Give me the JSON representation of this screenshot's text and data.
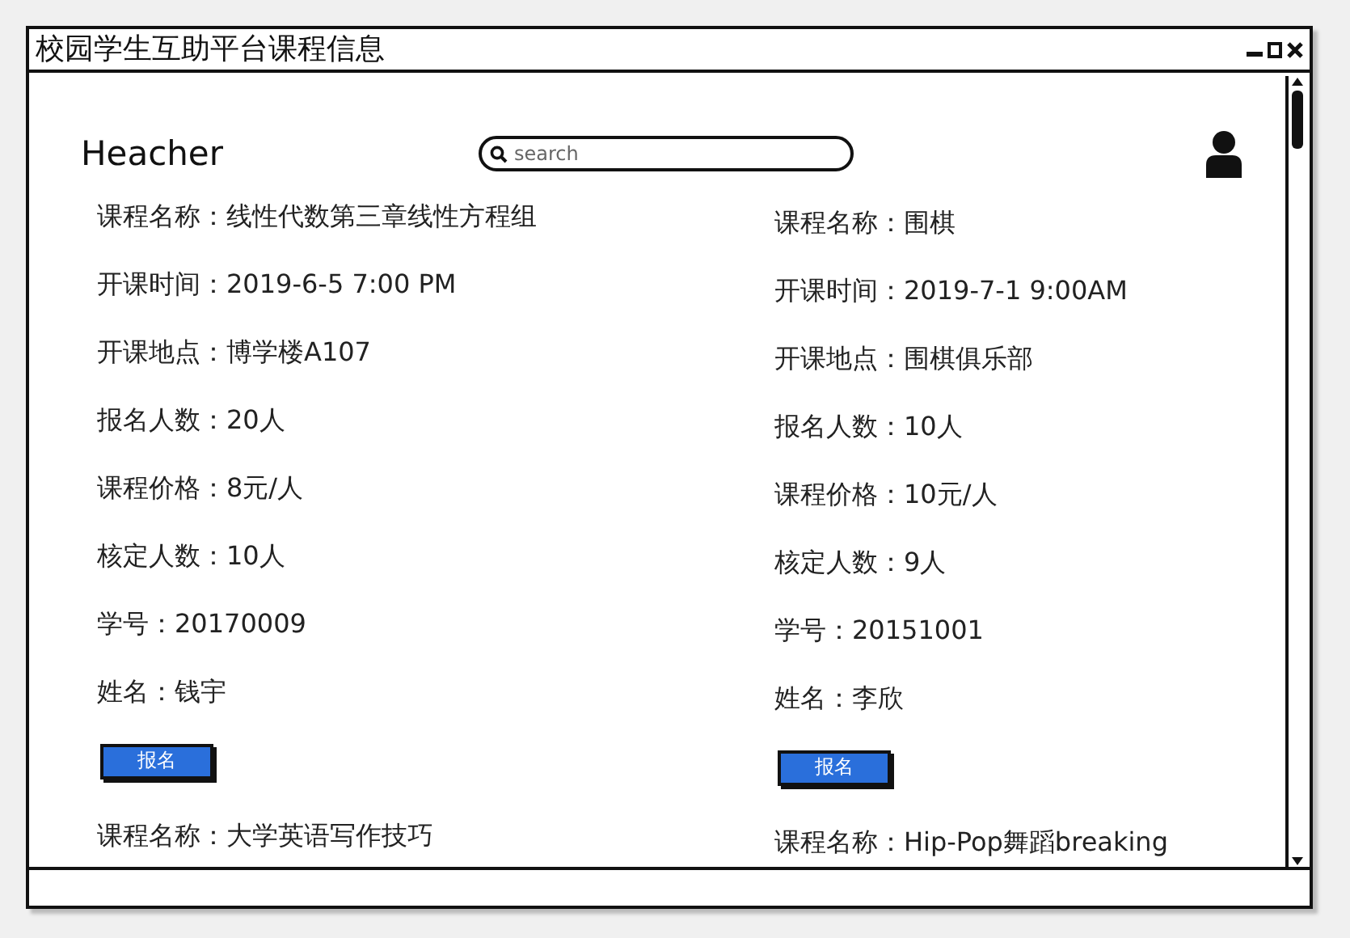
{
  "window": {
    "title": "校园学生互助平台课程信息"
  },
  "header": {
    "logo": "Heacher",
    "search": {
      "placeholder": "search"
    }
  },
  "courses": [
    {
      "fields": [
        "课程名称：线性代数第三章线性方程组",
        "开课时间：2019-6-5 7:00 PM",
        "开课地点：博学楼A107",
        "报名人数：20人",
        "课程价格：8元/人",
        "核定人数：10人",
        "学号：20170009",
        "姓名：钱宇"
      ],
      "button": "报名"
    },
    {
      "fields": [
        "课程名称：围棋",
        "开课时间：2019-7-1 9:00AM",
        "开课地点：围棋俱乐部",
        "报名人数：10人",
        "课程价格：10元/人",
        "核定人数：9人",
        "学号：20151001",
        "姓名：李欣"
      ],
      "button": "报名"
    },
    {
      "fields": [
        "课程名称：大学英语写作技巧"
      ]
    },
    {
      "fields": [
        "课程名称：Hip-Pop舞蹈breaking"
      ]
    }
  ]
}
